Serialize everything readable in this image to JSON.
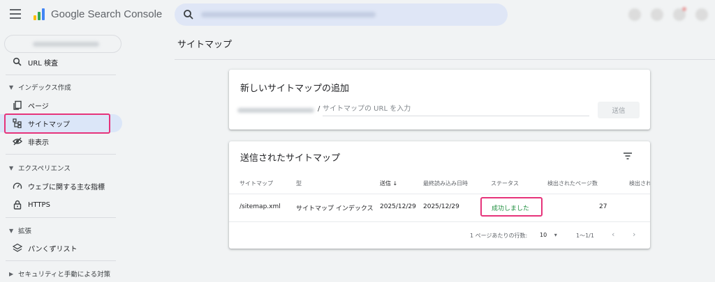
{
  "app": {
    "brand": "Google Search Console"
  },
  "search": {
    "placeholder": ""
  },
  "sidebar": {
    "url_inspection": "URL 検査",
    "index_section": "インデックス作成",
    "pages": "ページ",
    "sitemaps": "サイトマップ",
    "removals": "非表示",
    "experience_section": "エクスペリエンス",
    "core_web_vitals": "ウェブに関する主な指標",
    "https": "HTTPS",
    "enhancements_section": "拡張",
    "breadcrumbs": "パンくずリスト",
    "security_section": "セキュリティと手動による対策"
  },
  "main": {
    "page_title": "サイトマップ",
    "add_card": {
      "title": "新しいサイトマップの追加",
      "slash": "/",
      "input_placeholder": "サイトマップの URL を入力",
      "submit_label": "送信"
    },
    "list_card": {
      "title": "送信されたサイトマップ",
      "columns": [
        "サイトマップ",
        "型",
        "送信",
        "最終読み込み日時",
        "ステータス",
        "検出されたページ数",
        "検出され"
      ],
      "rows": [
        {
          "sitemap": "/sitemap.xml",
          "type": "サイトマップ インデックス",
          "submitted": "2025/12/29",
          "last_read": "2025/12/29",
          "status": "成功しました",
          "discovered_pages": "27"
        }
      ],
      "pagination": {
        "rows_per_page_label": "1 ページあたりの行数:",
        "rows_per_page_value": "10",
        "range": "1～1/1"
      }
    }
  },
  "colors": {
    "accent": "#1a73e8",
    "active_bg": "#dbe6f8",
    "highlight": "#e6337a",
    "success": "#1e8e3e"
  }
}
